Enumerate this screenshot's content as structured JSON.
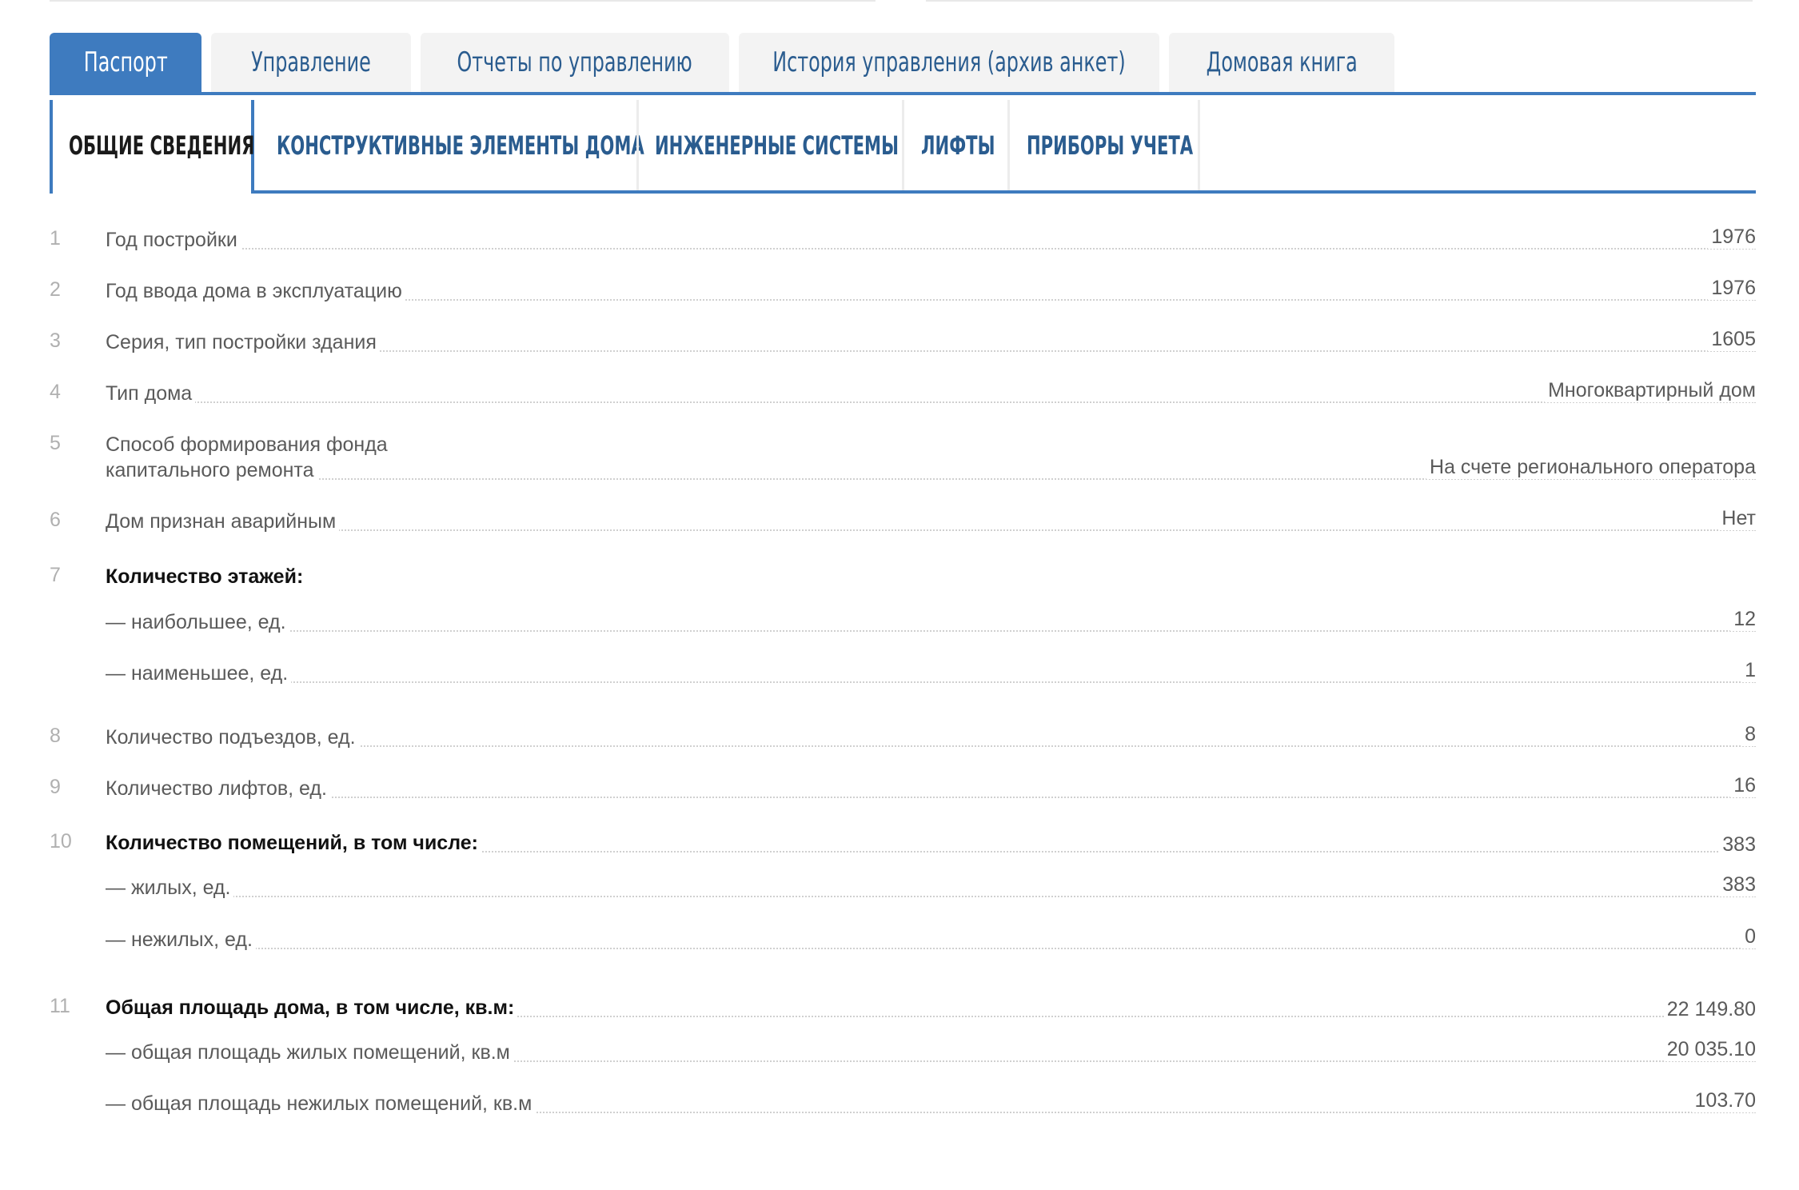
{
  "main_tabs": [
    "Паспорт",
    "Управление",
    "Отчеты по управлению",
    "История управления (архив анкет)",
    "Домовая книга"
  ],
  "sub_tabs": [
    "ОБЩИЕ СВЕДЕНИЯ",
    "КОНСТРУКТИВНЫЕ ЭЛЕМЕНТЫ ДОМА",
    "ИНЖЕНЕРНЫЕ СИСТЕМЫ",
    "ЛИФТЫ",
    "ПРИБОРЫ УЧЕТА"
  ],
  "rows": [
    {
      "num": "1",
      "label": "Год постройки",
      "value": "1976"
    },
    {
      "num": "2",
      "label": "Год ввода дома в эксплуатацию",
      "value": "1976"
    },
    {
      "num": "3",
      "label": "Серия, тип постройки здания",
      "value": "1605"
    },
    {
      "num": "4",
      "label": "Тип дома",
      "value": "Многоквартирный дом"
    },
    {
      "num": "5",
      "label_line1": "Способ формирования фонда",
      "label_line2": "капитального ремонта",
      "value": "На счете регионального оператора"
    },
    {
      "num": "6",
      "label": "Дом признан аварийным",
      "value": "Нет"
    },
    {
      "num": "7",
      "label": "Количество этажей:"
    },
    {
      "label": "— наибольшее, ед.",
      "value": "12"
    },
    {
      "label": "— наименьшее, ед.",
      "value": "1"
    },
    {
      "num": "8",
      "label": "Количество подъездов, ед.",
      "value": "8"
    },
    {
      "num": "9",
      "label": "Количество лифтов, ед.",
      "value": "16"
    },
    {
      "num": "10",
      "label": "Количество помещений, в том числе:",
      "value": "383"
    },
    {
      "label": "— жилых, ед.",
      "value": "383"
    },
    {
      "label": "— нежилых, ед.",
      "value": "0"
    },
    {
      "num": "11",
      "label": "Общая площадь дома, в том числе, кв.м:",
      "value": "22 149.80"
    },
    {
      "label": "— общая площадь жилых помещений, кв.м",
      "value": "20 035.10"
    },
    {
      "label": "— общая площадь нежилых помещений, кв.м",
      "value": "103.70"
    }
  ]
}
